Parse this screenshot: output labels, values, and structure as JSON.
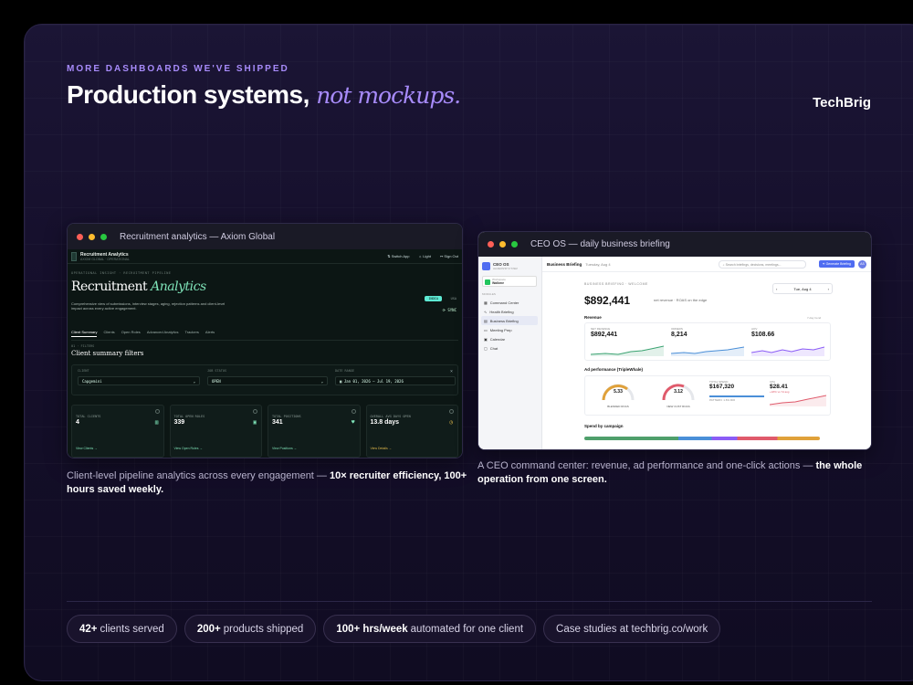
{
  "header": {
    "eyebrow": "MORE DASHBOARDS WE'VE SHIPPED",
    "title_main": "Production systems,",
    "title_accent": "not mockups.",
    "brand": "TechBrig"
  },
  "recruitment": {
    "window_title": "Recruitment analytics — Axiom Global",
    "app_title": "Recruitment Analytics",
    "app_sub": "AXIOM GLOBAL · OPERATIONAL",
    "top_buttons": [
      "Switch App",
      "Light",
      "Sign Out"
    ],
    "crumb": "OPERATIONAL INSIGHT · RECRUITMENT PIPELINE",
    "title_plain": "Recruitment",
    "title_accent": "Analytics",
    "description": "Comprehensive view of submissions, interview stages, aging, rejection patterns and client-level impact across every active engagement.",
    "badge": "INDIA",
    "badge2": "USA",
    "sync": "SYNC",
    "tabs": [
      "Client Summary",
      "Clients",
      "Open Roles",
      "Advanced Analytics",
      "Trackers",
      "Alerts"
    ],
    "section_label": "01 · FILTERS",
    "section_title": "Client summary filters",
    "filters": [
      {
        "label": "CLIENT",
        "value": "Capgemini"
      },
      {
        "label": "JOB STATUS",
        "value": "OPEN"
      },
      {
        "label": "DATE RANGE",
        "value": "Jan 01, 2026 – Jul 19, 2026"
      }
    ],
    "kpis": [
      {
        "label": "TOTAL CLIENTS",
        "value": "4",
        "link": "View Clients →"
      },
      {
        "label": "TOTAL OPEN ROLES",
        "value": "339",
        "link": "View Open Roles →"
      },
      {
        "label": "TOTAL POSITIONS",
        "value": "341",
        "link": "View Positions →"
      },
      {
        "label": "OVERALL AVG DAYS OPEN",
        "value": "13.8 days",
        "link": "View Details →"
      }
    ],
    "caption_plain": "Client-level pipeline analytics across every engagement — ",
    "caption_bold": "10× recruiter efficiency, 100+ hours saved weekly."
  },
  "ceo": {
    "window_title": "CEO OS — daily business briefing",
    "logo_title": "CEO OS",
    "logo_sub": "LEADERSHIP SYSTEM",
    "workspace_label": "Workspace",
    "workspace_name": "Walkme",
    "modules_label": "MODULES",
    "nav": [
      "Command Center",
      "Health Briefing",
      "Business Briefing",
      "Meeting Prep",
      "Calendar",
      "Chat"
    ],
    "page": "Business Briefing",
    "page_sub": "Tuesday, Aug 4",
    "search_placeholder": "Search briefings, decisions, meetings...",
    "generate": "Generate Briefing",
    "avatar": "AS",
    "eyebrow": "BUSINESS BRIEFING · WELCOME",
    "big_value": "$892,441",
    "big_sub": "net revenue · ROAS on the edge",
    "date": "Tue, Aug 4",
    "revenue_label": "Revenue",
    "revenue_link": "7-day trend",
    "revenue_kpis": [
      {
        "label": "NET REVENUE",
        "value": "$892,441"
      },
      {
        "label": "ORDERS",
        "value": "8,214"
      },
      {
        "label": "AOV",
        "value": "$108.66"
      }
    ],
    "ad_label": "Ad performance (TripleWhale)",
    "gauges": [
      {
        "value": "5.33",
        "label": "BLENDED ROAS"
      },
      {
        "value": "3.12",
        "label": "NEW CUST ROAS"
      }
    ],
    "spend_label": "TOTAL SPEND",
    "spend_value": "$167,320",
    "spend_sub": "PATTERN: 1.6% ROI",
    "cpa_label": "CPA",
    "cpa_value": "$28.41",
    "cpa_sub": "+18% vs 7d avg",
    "campaign_label": "Spend by campaign",
    "caption_plain": "A CEO command center: revenue, ad performance and one-click actions — ",
    "caption_bold": "the whole operation from one screen."
  },
  "pills": [
    {
      "bold": "42+",
      "text": "clients served"
    },
    {
      "bold": "200+",
      "text": "products shipped"
    },
    {
      "bold": "100+ hrs/week",
      "text": "automated for one client"
    },
    {
      "bold": "",
      "text": "Case studies at techbrig.co/work"
    }
  ],
  "colors": {
    "accent": "#a78bfa",
    "mint": "#7ee3b8",
    "blue": "#4f6cf1"
  }
}
